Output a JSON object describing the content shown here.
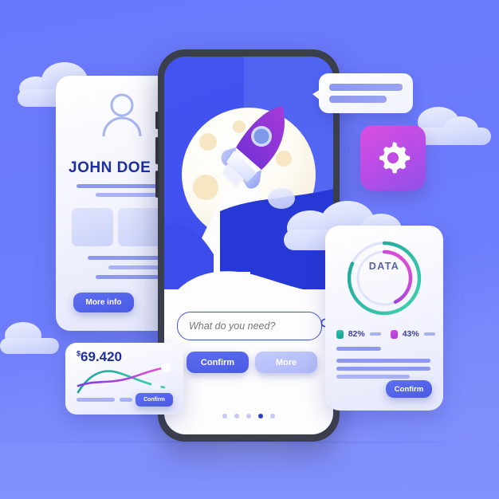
{
  "background": {
    "color": "#6b7bfb",
    "horizon_color": "#8290fd"
  },
  "profile_card": {
    "name": "JOHN DOE",
    "avatar_icon": "user-avatar-icon",
    "more_info_label": "More info"
  },
  "phone": {
    "illustration": {
      "rocket_icon": "rocket-icon",
      "moon_icon": "moon-icon"
    },
    "search": {
      "placeholder": "What do you need?",
      "value": "",
      "icon": "search-icon"
    },
    "confirm_label": "Confirm",
    "more_label": "More",
    "pagination": {
      "count": 5,
      "active_index": 3
    }
  },
  "speech_bubble": {
    "icon": "chat-bubble-icon",
    "lines": 2
  },
  "gear_tile": {
    "icon": "gear-icon",
    "color": "#b64ce6"
  },
  "data_card": {
    "title": "DATA",
    "confirm_label": "Confirm",
    "legend": [
      {
        "label": "82%",
        "color": "#27b3a3"
      },
      {
        "label": "43%",
        "color": "#c542e0"
      }
    ]
  },
  "chart_card": {
    "currency_symbol": "$",
    "amount": "69.420",
    "confirm_label": "Confirm"
  },
  "chart_data": {
    "type": "line",
    "title": "$69.420",
    "x": [
      0,
      1,
      2,
      3,
      4,
      5
    ],
    "series": [
      {
        "name": "teal",
        "color": "#27b3a3",
        "values": [
          8,
          34,
          44,
          42,
          28,
          22
        ]
      },
      {
        "name": "magenta",
        "color": "#c542e0",
        "values": [
          18,
          22,
          24,
          30,
          46,
          52
        ]
      }
    ],
    "xlabel": "",
    "ylabel": "",
    "grid": false,
    "legend_position": "none"
  },
  "donut_chart": {
    "type": "pie",
    "title": "DATA",
    "rings": [
      {
        "name": "82%",
        "value": 82,
        "color_start": "#1f9f9a",
        "color_end": "#3fd0b0"
      },
      {
        "name": "43%",
        "value": 43,
        "color_start": "#7b3fe4",
        "color_end": "#e94fd0"
      }
    ]
  }
}
